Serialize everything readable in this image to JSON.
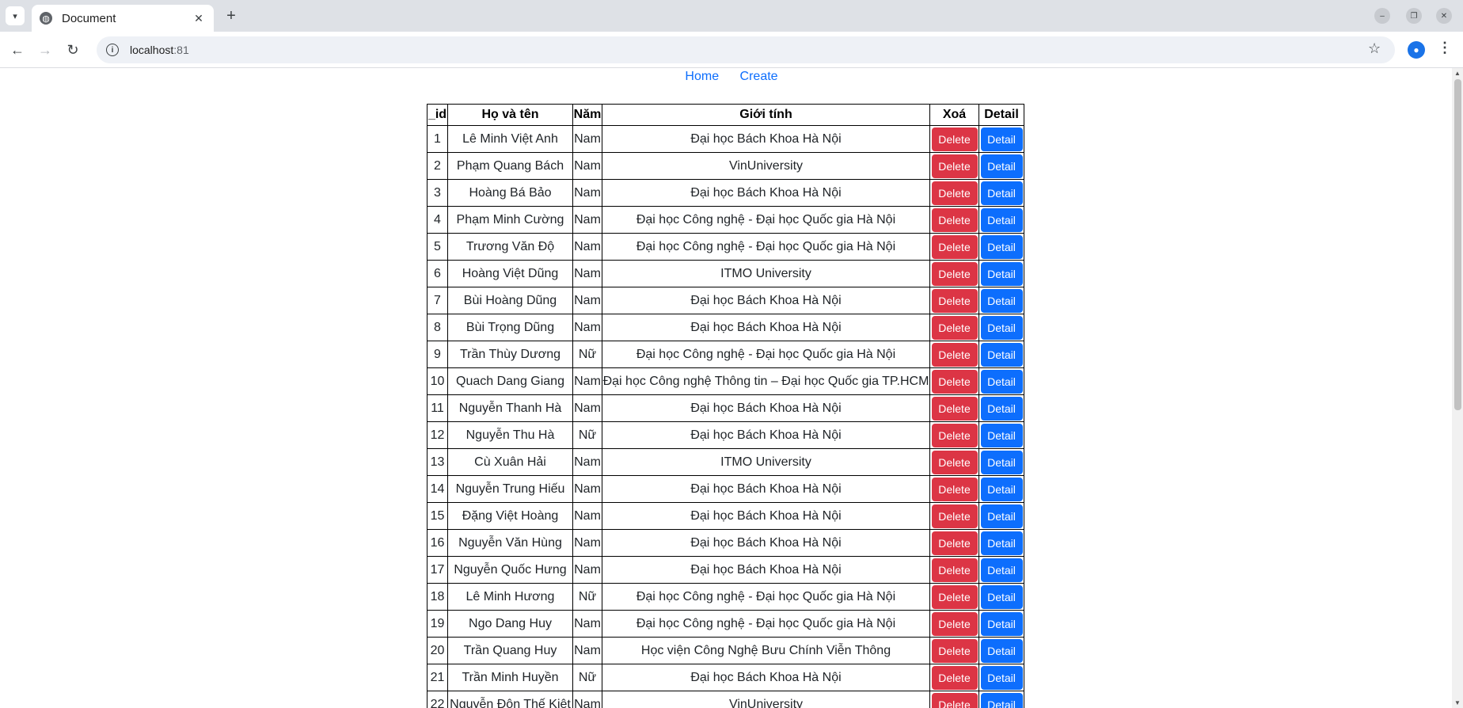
{
  "browser": {
    "tab_title": "Document",
    "url_host": "localhost",
    "url_port": ":81"
  },
  "nav": {
    "home": "Home",
    "create": "Create"
  },
  "table": {
    "headers": [
      "_id",
      "Họ và tên",
      "Năm",
      "Giới tính",
      "Xoá",
      "Detail"
    ],
    "delete_label": "Delete",
    "detail_label": "Detail",
    "rows": [
      {
        "id": "1",
        "name": "Lê Minh Việt Anh",
        "year": "Nam",
        "school": "Đại học Bách Khoa Hà Nội"
      },
      {
        "id": "2",
        "name": "Phạm Quang Bách",
        "year": "Nam",
        "school": "VinUniversity"
      },
      {
        "id": "3",
        "name": "Hoàng Bá Bảo",
        "year": "Nam",
        "school": "Đại học Bách Khoa Hà Nội"
      },
      {
        "id": "4",
        "name": "Phạm Minh Cường",
        "year": "Nam",
        "school": "Đại học Công nghệ - Đại học Quốc gia Hà Nội"
      },
      {
        "id": "5",
        "name": "Trương Văn Độ",
        "year": "Nam",
        "school": "Đại học Công nghệ - Đại học Quốc gia Hà Nội"
      },
      {
        "id": "6",
        "name": "Hoàng Việt Dũng",
        "year": "Nam",
        "school": "ITMO University"
      },
      {
        "id": "7",
        "name": "Bùi Hoàng Dũng",
        "year": "Nam",
        "school": "Đại học Bách Khoa Hà Nội"
      },
      {
        "id": "8",
        "name": "Bùi Trọng Dũng",
        "year": "Nam",
        "school": "Đại học Bách Khoa Hà Nội"
      },
      {
        "id": "9",
        "name": "Trần Thùy Dương",
        "year": "Nữ",
        "school": "Đại học Công nghệ - Đại học Quốc gia Hà Nội"
      },
      {
        "id": "10",
        "name": "Quach Dang Giang",
        "year": "Nam",
        "school": "Đại học Công nghệ Thông tin – Đại học Quốc gia TP.HCM"
      },
      {
        "id": "11",
        "name": "Nguyễn Thanh Hà",
        "year": "Nam",
        "school": "Đại học Bách Khoa Hà Nội"
      },
      {
        "id": "12",
        "name": "Nguyễn Thu Hà",
        "year": "Nữ",
        "school": "Đại học Bách Khoa Hà Nội"
      },
      {
        "id": "13",
        "name": "Cù Xuân Hải",
        "year": "Nam",
        "school": "ITMO University"
      },
      {
        "id": "14",
        "name": "Nguyễn Trung Hiếu",
        "year": "Nam",
        "school": "Đại học Bách Khoa Hà Nội"
      },
      {
        "id": "15",
        "name": "Đặng Việt Hoàng",
        "year": "Nam",
        "school": "Đại học Bách Khoa Hà Nội"
      },
      {
        "id": "16",
        "name": "Nguyễn Văn Hùng",
        "year": "Nam",
        "school": "Đại học Bách Khoa Hà Nội"
      },
      {
        "id": "17",
        "name": "Nguyễn Quốc Hưng",
        "year": "Nam",
        "school": "Đại học Bách Khoa Hà Nội"
      },
      {
        "id": "18",
        "name": "Lê Minh Hương",
        "year": "Nữ",
        "school": "Đại học Công nghệ - Đại học Quốc gia Hà Nội"
      },
      {
        "id": "19",
        "name": "Ngo Dang Huy",
        "year": "Nam",
        "school": "Đại học Công nghệ - Đại học Quốc gia Hà Nội"
      },
      {
        "id": "20",
        "name": "Trần Quang Huy",
        "year": "Nam",
        "school": "Học viện Công Nghệ Bưu Chính Viễn Thông"
      },
      {
        "id": "21",
        "name": "Trần Minh Huyền",
        "year": "Nữ",
        "school": "Đại học Bách Khoa Hà Nội"
      },
      {
        "id": "22",
        "name": "Nguyễn Đôn Thế Kiệt",
        "year": "Nam",
        "school": "VinUniversity"
      }
    ]
  },
  "colors": {
    "delete": "#dc3545",
    "detail": "#0d6efd",
    "link": "#0d6efd"
  }
}
